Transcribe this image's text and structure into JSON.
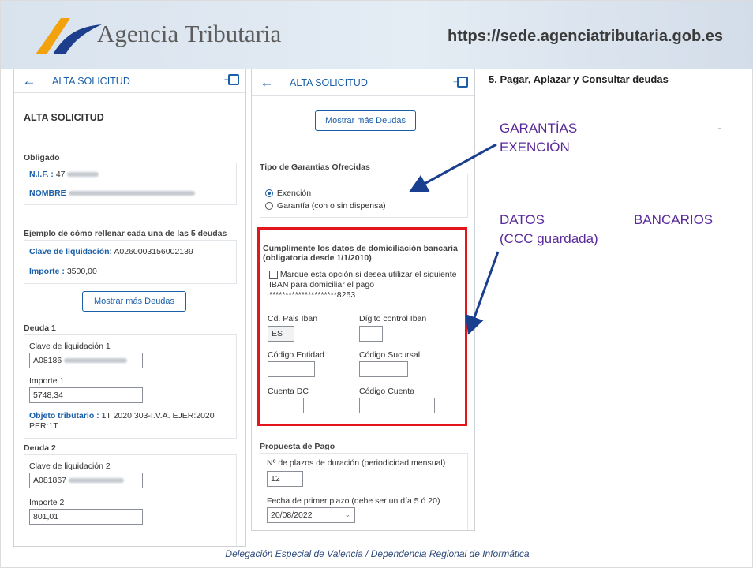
{
  "header": {
    "agency_name": "Agencia Tributaria",
    "url": "https://sede.agenciatributaria.gob.es"
  },
  "left_panel": {
    "topbar_title": "ALTA SOLICITUD",
    "heading": "ALTA SOLICITUD",
    "obligado_label": "Obligado",
    "nif_label": "N.I.F. :",
    "nif_value": "47",
    "nombre_label": "NOMBRE",
    "ejemplo_label": "Ejemplo de cómo rellenar cada una de las 5 deudas",
    "clave_label": "Clave de liquidación:",
    "clave_value": "A0260003156002139",
    "importe_label": "Importe :",
    "importe_value": "3500,00",
    "mostrar_btn": "Mostrar más Deudas",
    "deuda1": {
      "heading": "Deuda 1",
      "clave_label": "Clave de liquidación 1",
      "clave_value": "A08186",
      "importe_label": "Importe 1",
      "importe_value": "5748,34",
      "objeto_label": "Objeto tributario :",
      "objeto_value": "1T 2020 303-I.V.A. EJER:2020 PER:1T"
    },
    "deuda2": {
      "heading": "Deuda 2",
      "clave_label": "Clave de liquidación 2",
      "clave_value": "A081867",
      "importe_label": "Importe 2",
      "importe_value": "801,01"
    }
  },
  "mid_panel": {
    "topbar_title": "ALTA SOLICITUD",
    "mostrar_btn": "Mostrar más Deudas",
    "garantias_label": "Tipo de Garantias Ofrecidas",
    "radio_exencion": "Exención",
    "radio_garantia": "Garantía (con o sin dispensa)",
    "domiciliacion_title": "Cumplimente los datos de domiciliación bancaria (obligatoria desde 1/1/2010)",
    "checkbox_text": "Marque esta opción si desea utilizar el siguiente IBAN para domiciliar el pago",
    "iban_masked": "*********************8253",
    "cd_pais_label": "Cd. Pais Iban",
    "cd_pais_value": "ES",
    "digito_label": "Dígito control Iban",
    "entidad_label": "Código Entidad",
    "sucursal_label": "Código Sucursal",
    "cuenta_dc_label": "Cuenta DC",
    "codigo_cuenta_label": "Código Cuenta",
    "propuesta_label": "Propuesta de Pago",
    "plazos_label": "Nº de plazos de duración (periodicidad mensual)",
    "plazos_value": "12",
    "fecha_label": "Fecha de primer plazo (debe ser un día 5 ó 20)",
    "fecha_value": "20/08/2022"
  },
  "right": {
    "section_title": "5. Pagar, Aplazar y Consultar deudas",
    "annot_garantias_1": "GARANTÍAS",
    "annot_garantias_dash": "-",
    "annot_garantias_2": "EXENCIÓN",
    "annot_datos_1": "DATOS",
    "annot_datos_2": "BANCARIOS",
    "annot_datos_3": "(CCC guardada)"
  },
  "footer": {
    "text": "Delegación Especial de Valencia / Dependencia Regional de Informática"
  },
  "colors": {
    "link_blue": "#1b5fa8",
    "highlight_red": "#e3161b",
    "annotation_purple": "#5a2a9a",
    "arrow_blue": "#1a3f8f"
  },
  "icons": [
    "back-arrow-icon",
    "exit-icon",
    "agency-logo-icon",
    "chevron-down-icon"
  ]
}
